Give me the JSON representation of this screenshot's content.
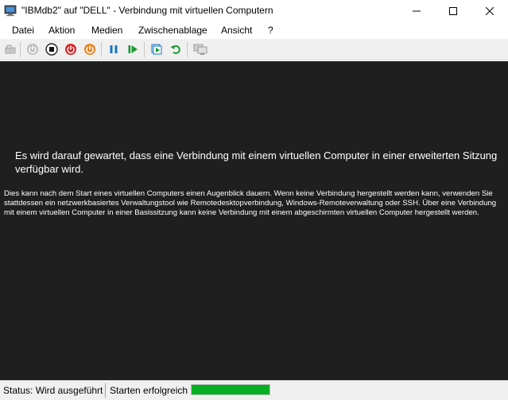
{
  "window": {
    "title": "\"IBMdb2\" auf \"DELL\" - Verbindung mit virtuellen Computern",
    "app_icon": "hyper-v-connection-icon"
  },
  "menu": [
    {
      "label": "Datei"
    },
    {
      "label": "Aktion"
    },
    {
      "label": "Medien"
    },
    {
      "label": "Zwischenablage"
    },
    {
      "label": "Ansicht"
    },
    {
      "label": "?"
    }
  ],
  "toolbar": {
    "icons": [
      "ctrl-alt-del-icon",
      "start-icon",
      "turn-off-icon",
      "shut-down-icon",
      "save-state-icon",
      "pause-icon",
      "resume-icon",
      "checkpoint-icon",
      "revert-icon",
      "enhanced-session-icon"
    ],
    "colors": {
      "turn_off": "#d81e1e",
      "shut_down": "#e8811a",
      "pause_resume": "#1a9b2f",
      "checkpoint": "#1673c6"
    }
  },
  "content": {
    "main_message": "Es wird darauf gewartet, dass eine Verbindung mit einem virtuellen Computer in einer erweiterten Sitzung verfügbar wird.",
    "detail_message": "Dies kann nach dem Start eines virtuellen Computers einen Augenblick dauern. Wenn keine Verbindung hergestellt werden kann, verwenden Sie stattdessen ein netzwerkbasiertes Verwaltungstool wie Remotedesktopverbindung, Windows-Remoteverwaltung oder SSH. Über eine Verbindung mit einem virtuellen Computer in einer Basissitzung kann keine Verbindung mit einem abgeschirmten virtuellen Computer hergestellt werden.",
    "background": "#1f1f1f"
  },
  "status": {
    "state": "Status: Wird ausgeführt",
    "operation": "Starten erfolgreich",
    "progress": 1.0,
    "progress_color": "#06b025"
  }
}
